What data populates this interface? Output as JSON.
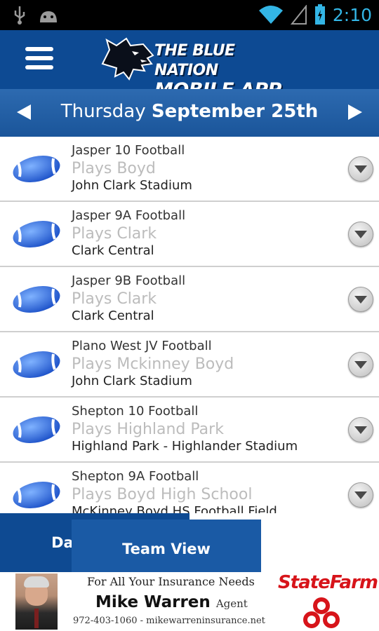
{
  "status_bar": {
    "time": "2:10"
  },
  "header": {
    "logo_line1": "THE BLUE NATION",
    "logo_line2": "MOBILE APP"
  },
  "date_bar": {
    "weekday": "Thursday",
    "date": "September 25th"
  },
  "games": [
    {
      "team": "Jasper 10 Football",
      "opponent": "Plays Boyd",
      "venue": "John Clark Stadium"
    },
    {
      "team": "Jasper 9A Football",
      "opponent": "Plays Clark",
      "venue": "Clark Central"
    },
    {
      "team": "Jasper 9B Football",
      "opponent": "Plays Clark",
      "venue": "Clark Central"
    },
    {
      "team": "Plano West JV Football",
      "opponent": "Plays Mckinney Boyd",
      "venue": "John Clark Stadium"
    },
    {
      "team": "Shepton 10 Football",
      "opponent": "Plays Highland Park",
      "venue": "Highland Park - Highlander Stadium"
    },
    {
      "team": "Shepton 9A Football",
      "opponent": "Plays Boyd High School",
      "venue": "McKinney Boyd HS Football Field"
    }
  ],
  "tabs": {
    "daily": "Daily View",
    "team": "Team View"
  },
  "ad": {
    "tagline": "For All Your Insurance Needs",
    "name": "Mike Warren",
    "title": "Agent",
    "contact": "972-403-1060 - mikewarreninsurance.net",
    "brand": "StateFarm"
  },
  "colors": {
    "header": "#0d4a93",
    "status_accent": "#33b5e5",
    "statefarm_red": "#d7141a"
  }
}
